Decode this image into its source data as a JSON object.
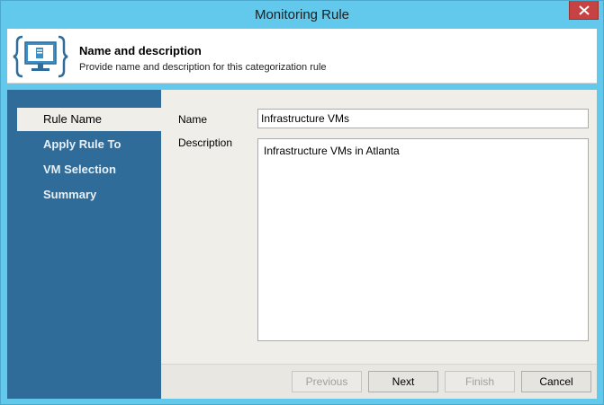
{
  "window": {
    "title": "Monitoring Rule"
  },
  "header": {
    "title": "Name and description",
    "subtitle": "Provide name and description for this categorization rule",
    "icon": "monitor-braces-icon"
  },
  "sidebar": {
    "items": [
      {
        "label": "Rule Name",
        "active": true
      },
      {
        "label": "Apply Rule To",
        "active": false
      },
      {
        "label": "VM Selection",
        "active": false
      },
      {
        "label": "Summary",
        "active": false
      }
    ]
  },
  "form": {
    "name_label": "Name",
    "name_value": "Infrastructure VMs",
    "description_label": "Description",
    "description_value": "Infrastructure VMs in Atlanta"
  },
  "buttons": {
    "previous": "Previous",
    "next": "Next",
    "finish": "Finish",
    "cancel": "Cancel"
  },
  "colors": {
    "titlebar": "#62c9ec",
    "sidebar": "#2f6c99",
    "close": "#c74343"
  }
}
